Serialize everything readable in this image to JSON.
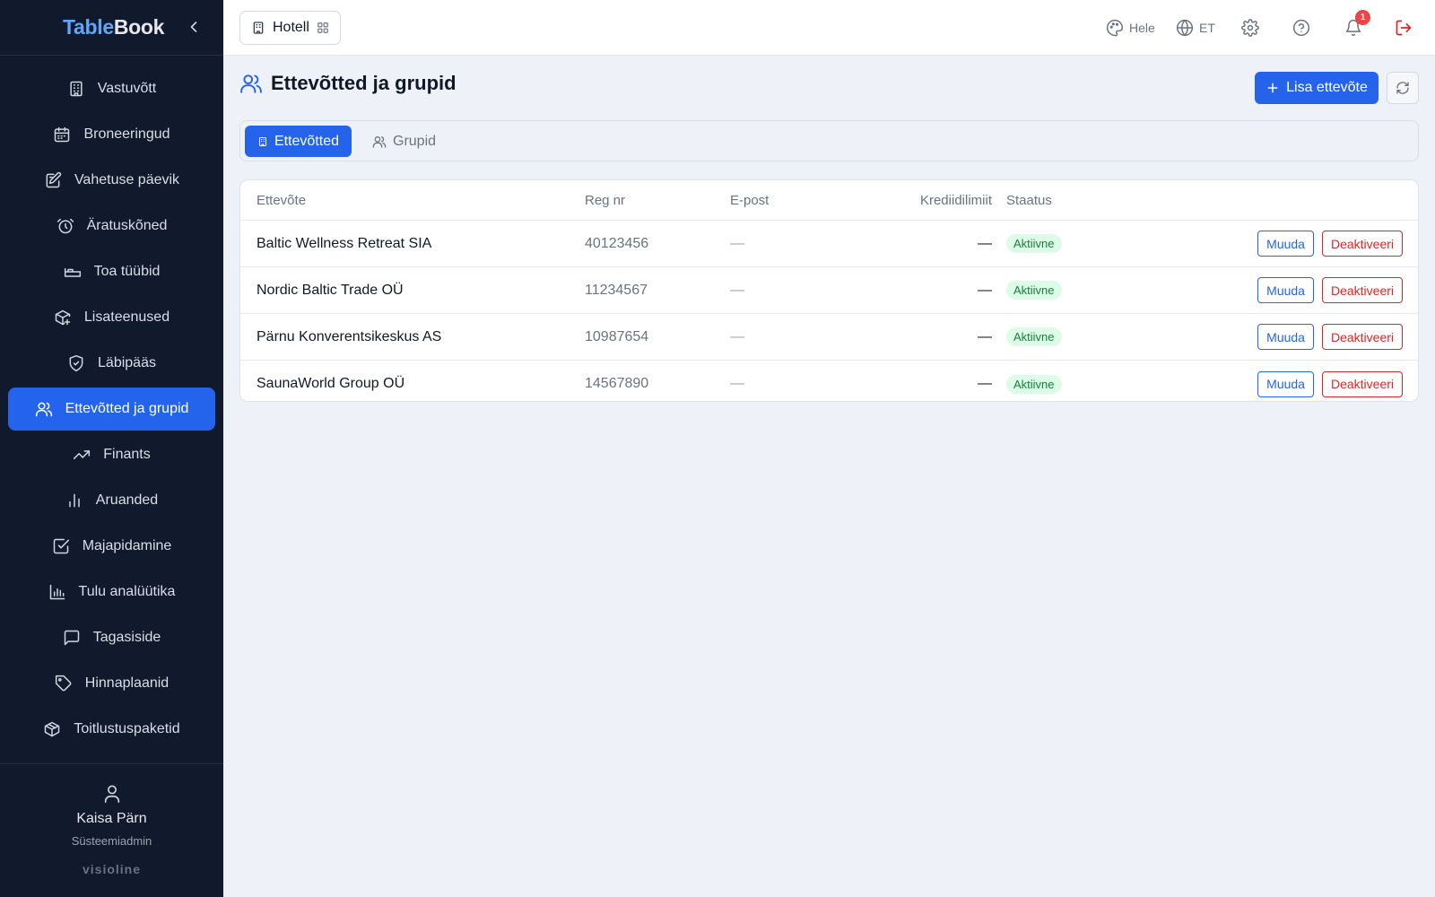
{
  "app": {
    "brand_part1": "Table",
    "brand_part2": "Book",
    "footer_brand": "visioline"
  },
  "sidebar": {
    "items": [
      {
        "label": "Vastuvõtt",
        "icon": "building-icon",
        "active": false
      },
      {
        "label": "Broneeringud",
        "icon": "calendar-icon",
        "active": false
      },
      {
        "label": "Vahetuse päevik",
        "icon": "edit-note-icon",
        "active": false
      },
      {
        "label": "Äratuskõned",
        "icon": "alarm-clock-icon",
        "active": false
      },
      {
        "label": "Toa tüübid",
        "icon": "bed-icon",
        "active": false
      },
      {
        "label": "Lisateenused",
        "icon": "package-plus-icon",
        "active": false
      },
      {
        "label": "Läbipääs",
        "icon": "shield-check-icon",
        "active": false
      },
      {
        "label": "Ettevõtted ja grupid",
        "icon": "users-icon",
        "active": true
      },
      {
        "label": "Finants",
        "icon": "trending-up-icon",
        "active": false
      },
      {
        "label": "Aruanded",
        "icon": "bar-chart-icon",
        "active": false
      },
      {
        "label": "Majapidamine",
        "icon": "checkbox-icon",
        "active": false
      },
      {
        "label": "Tulu analüütika",
        "icon": "chart-icon",
        "active": false
      },
      {
        "label": "Tagasiside",
        "icon": "message-icon",
        "active": false
      },
      {
        "label": "Hinnaplaanid",
        "icon": "tag-icon",
        "active": false
      },
      {
        "label": "Toitlustuspaketid",
        "icon": "box-icon",
        "active": false
      }
    ],
    "user": {
      "name": "Kaisa Pärn",
      "role": "Süsteemiadmin"
    }
  },
  "topbar": {
    "hotel_label": "Hotell",
    "theme_label": "Hele",
    "language_label": "ET",
    "notification_count": "1"
  },
  "page": {
    "title": "Ettevõtted ja grupid",
    "add_button": "Lisa ettevõte",
    "tabs": [
      {
        "label": "Ettevõtted",
        "active": true
      },
      {
        "label": "Grupid",
        "active": false
      }
    ]
  },
  "table": {
    "headers": {
      "name": "Ettevõte",
      "reg": "Reg nr",
      "email": "E-post",
      "credit": "Krediidilimiit",
      "status": "Staatus"
    },
    "rows": [
      {
        "name": "Baltic Wellness Retreat SIA",
        "reg": "40123456",
        "email": "—",
        "credit": "—",
        "status": "Aktiivne",
        "edit": "Muuda",
        "deactivate": "Deaktiveeri"
      },
      {
        "name": "Nordic Baltic Trade OÜ",
        "reg": "11234567",
        "email": "—",
        "credit": "—",
        "status": "Aktiivne",
        "edit": "Muuda",
        "deactivate": "Deaktiveeri"
      },
      {
        "name": "Pärnu Konverentsikeskus AS",
        "reg": "10987654",
        "email": "—",
        "credit": "—",
        "status": "Aktiivne",
        "edit": "Muuda",
        "deactivate": "Deaktiveeri"
      },
      {
        "name": "SaunaWorld Group OÜ",
        "reg": "14567890",
        "email": "—",
        "credit": "—",
        "status": "Aktiivne",
        "edit": "Muuda",
        "deactivate": "Deaktiveeri"
      }
    ]
  },
  "colors": {
    "sidebar_bg": "#111a2c",
    "accent": "#2563eb",
    "danger": "#dc2626",
    "success_bg": "#dcfce7",
    "success_text": "#15803d"
  }
}
